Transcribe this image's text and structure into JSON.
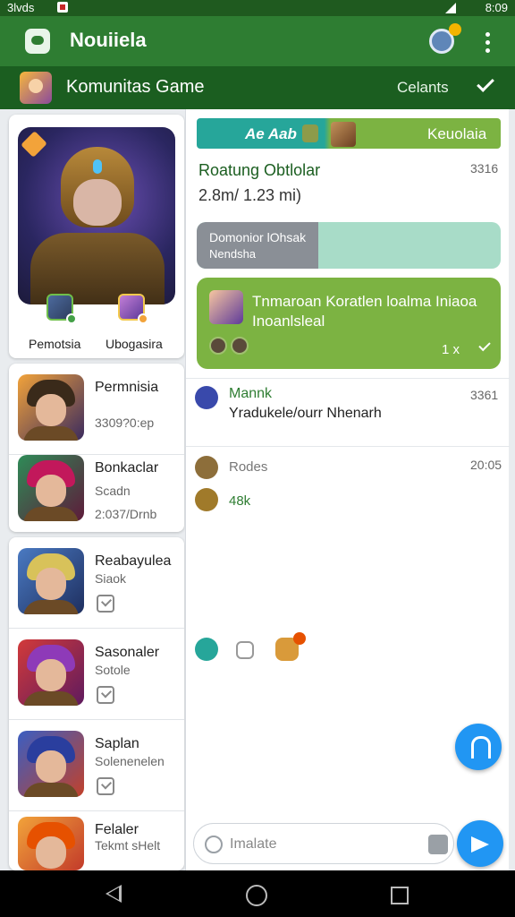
{
  "status_bar": {
    "left_text": "3lvds",
    "time": "8:09"
  },
  "app_bar": {
    "title": "Nouiiela"
  },
  "community": {
    "title": "Komunitas Game",
    "link_label": "Celants"
  },
  "featured": {
    "labels": [
      "Pemotsia",
      "Ubogasira"
    ]
  },
  "heroes": [
    {
      "name": "Permnisia",
      "sub": "",
      "sub2": "3309?0:ep",
      "check": false
    },
    {
      "name": "Bonkaclar",
      "sub": "Scadn",
      "sub2": "2:037/Drnb",
      "check": false
    },
    {
      "name": "Reabayulea",
      "sub": "Siaok",
      "sub2": "",
      "check": true
    },
    {
      "name": "Sasonaler",
      "sub": "Sotole",
      "sub2": "",
      "check": true
    },
    {
      "name": "Saplan",
      "sub": "Solenenelen",
      "sub2": "",
      "check": true
    },
    {
      "name": "Felaler",
      "sub": "Tekmt sHelt",
      "sub2": "",
      "check": false
    }
  ],
  "chat": {
    "tab_left": "Ae Aab",
    "tab_right": "Keuolaia",
    "header_title": "Roatung Obtlolar",
    "header_time": "3316",
    "header_meta": "2.8m/ 1.23 mi)",
    "status_line1": "Domonior lOhsak",
    "status_line2": "Nendsha",
    "status_progress": 0.4,
    "green_message": "Tnmaroan Koratlen loalma Iniaoa Inoanlsleal",
    "green_count": "1 x",
    "msg1_name": "Mannk",
    "msg1_text": "Yradukele/ourr Nhenarh",
    "msg1_time": "3361",
    "msg2_label": "Rodes",
    "msg2_time": "20:05",
    "msg2_value": "48k",
    "input_placeholder": "Imalate"
  },
  "colors": {
    "app_bar": "#2e7d32",
    "community_bar": "#1b5e20",
    "tab_teal": "#26a69a",
    "tab_green": "#7cb342",
    "fab_blue": "#2196f3"
  }
}
